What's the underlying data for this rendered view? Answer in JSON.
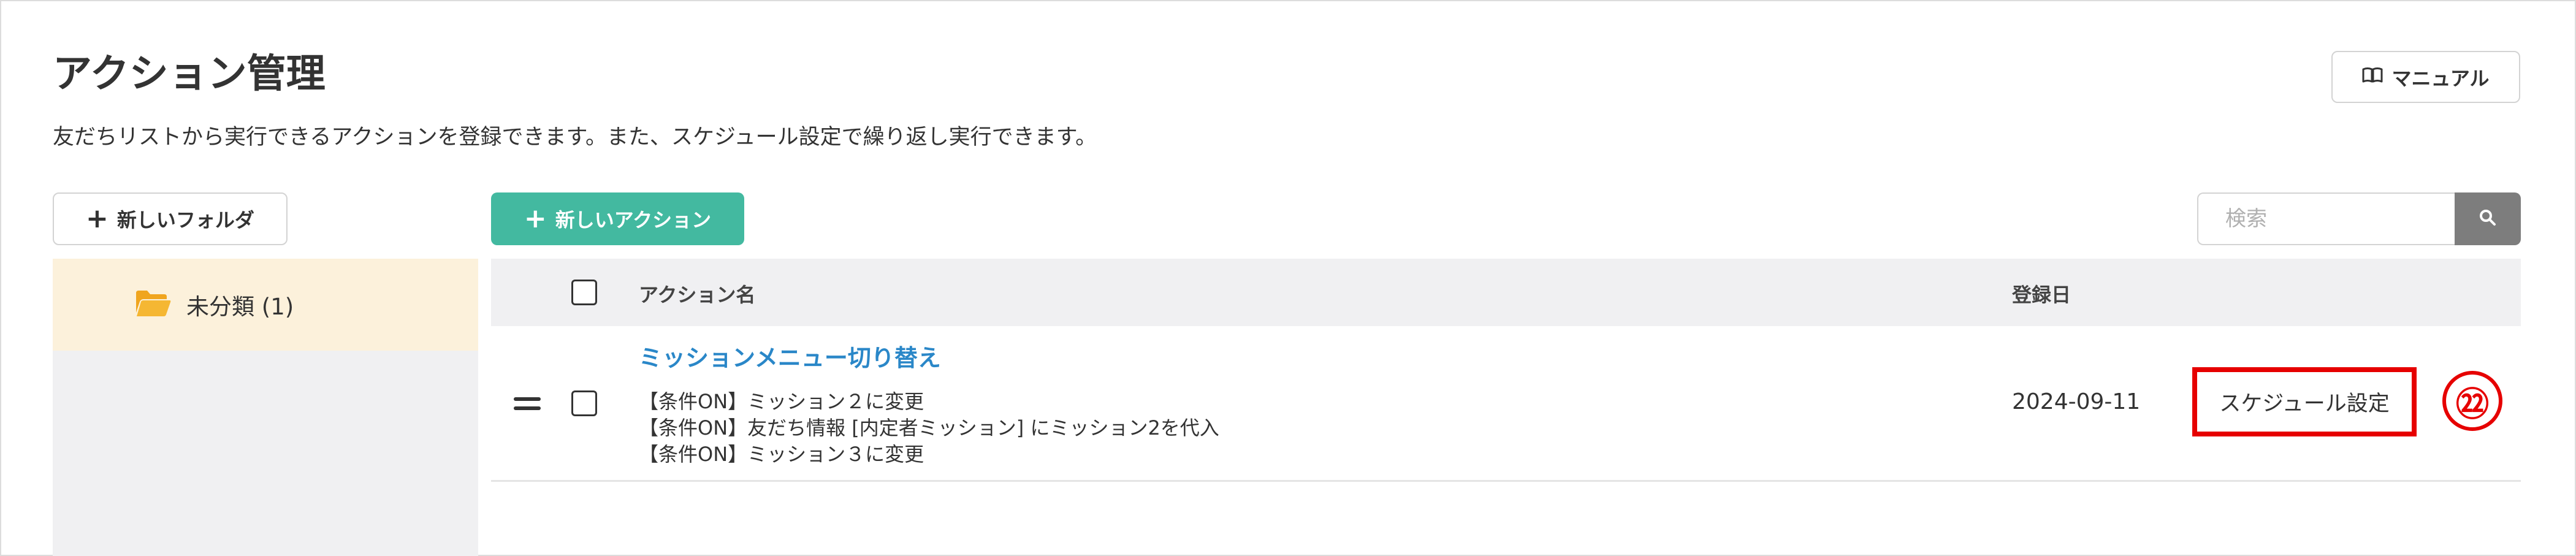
{
  "page": {
    "title": "アクション管理",
    "description": "友だちリストから実行できるアクションを登録できます。また、スケジュール設定で繰り返し実行できます。"
  },
  "header": {
    "manual_label": "マニュアル",
    "manual_icon": "book-icon"
  },
  "toolbar": {
    "new_folder_label": "新しいフォルダ",
    "new_action_label": "新しいアクション",
    "search_placeholder": "検索",
    "search_value": ""
  },
  "sidebar": {
    "folders": [
      {
        "label": "未分類 (1)",
        "icon": "folder-open-icon"
      }
    ]
  },
  "table": {
    "columns": {
      "name": "アクション名",
      "date": "登録日"
    },
    "rows": [
      {
        "name": "ミッションメニュー切り替え",
        "details": [
          "【条件ON】ミッション２に変更",
          "【条件ON】友だち情報 [内定者ミッション] にミッション2を代入",
          "【条件ON】ミッション３に変更"
        ],
        "date": "2024-09-11",
        "schedule_label": "スケジュール設定"
      }
    ]
  },
  "annotation": {
    "callout": "㉒"
  },
  "colors": {
    "accent": "#43b9a0",
    "link": "#2a87c8",
    "highlight": "#e60000",
    "folder": "#f0a51e",
    "folder_selected_bg": "#fcf1db"
  }
}
